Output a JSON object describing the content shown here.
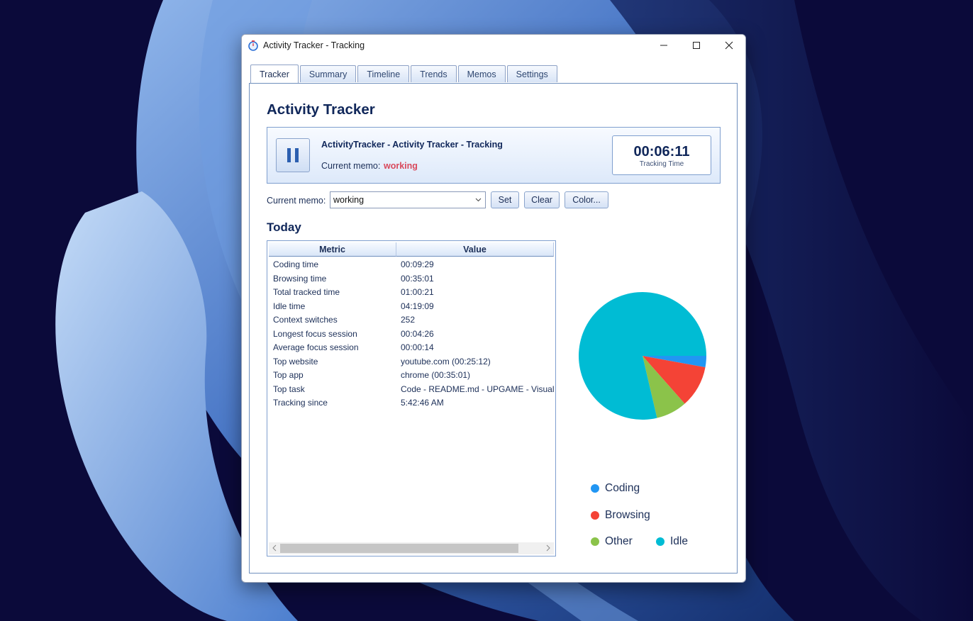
{
  "window": {
    "title": "Activity Tracker - Tracking"
  },
  "tabs": [
    "Tracker",
    "Summary",
    "Timeline",
    "Trends",
    "Memos",
    "Settings"
  ],
  "tracker": {
    "heading": "Activity Tracker",
    "status_line": "ActivityTracker - Activity Tracker - Tracking",
    "memo_label": "Current memo:",
    "memo_value": "working",
    "memo_value_color": "#d9495c",
    "timer": {
      "value": "00:06:11",
      "label": "Tracking Time"
    }
  },
  "memo_controls": {
    "label": "Current memo:",
    "value": "working",
    "set": "Set",
    "clear": "Clear",
    "color": "Color..."
  },
  "today": {
    "title": "Today",
    "columns": [
      "Metric",
      "Value"
    ],
    "rows": [
      {
        "metric": "Coding time",
        "value": "00:09:29"
      },
      {
        "metric": "Browsing time",
        "value": "00:35:01"
      },
      {
        "metric": "Total tracked time",
        "value": "01:00:21"
      },
      {
        "metric": "Idle time",
        "value": "04:19:09"
      },
      {
        "metric": "Context switches",
        "value": "252"
      },
      {
        "metric": "Longest focus session",
        "value": "00:04:26"
      },
      {
        "metric": "Average focus session",
        "value": "00:00:14"
      },
      {
        "metric": "Top website",
        "value": "youtube.com (00:25:12)"
      },
      {
        "metric": "Top app",
        "value": "chrome (00:35:01)"
      },
      {
        "metric": "Top task",
        "value": "Code - README.md - UPGAME - Visual S"
      },
      {
        "metric": "Tracking since",
        "value": "5:42:46 AM"
      }
    ]
  },
  "chart_data": {
    "type": "pie",
    "categories": [
      "Coding",
      "Browsing",
      "Other",
      "Idle"
    ],
    "values": [
      569,
      2101,
      1551,
      15549
    ],
    "colors": [
      "#2196f3",
      "#f44336",
      "#8bc34a",
      "#00bcd4"
    ],
    "legend": [
      "Coding",
      "Browsing",
      "Other",
      "Idle"
    ]
  }
}
